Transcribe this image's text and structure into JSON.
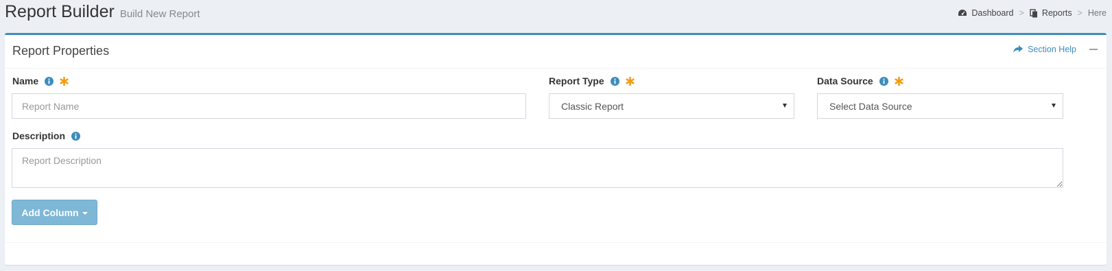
{
  "header": {
    "title": "Report Builder",
    "subtitle": "Build New Report"
  },
  "breadcrumb": {
    "items": [
      {
        "label": "Dashboard",
        "icon": "dashboard-icon"
      },
      {
        "label": "Reports",
        "icon": "reports-icon"
      },
      {
        "label": "Here"
      }
    ],
    "separator": ">"
  },
  "box": {
    "title": "Report Properties",
    "help_label": "Section Help",
    "accent_color": "#3c8dbc"
  },
  "form": {
    "name": {
      "label": "Name",
      "placeholder": "Report Name",
      "value": ""
    },
    "report_type": {
      "label": "Report Type",
      "selected": "Classic Report"
    },
    "data_source": {
      "label": "Data Source",
      "selected": "Select Data Source"
    },
    "description": {
      "label": "Description",
      "placeholder": "Report Description",
      "value": ""
    },
    "add_column_label": "Add Column"
  },
  "colors": {
    "info": "#3c8dbc",
    "required": "#f39c12",
    "button": "#7fb7d7"
  }
}
